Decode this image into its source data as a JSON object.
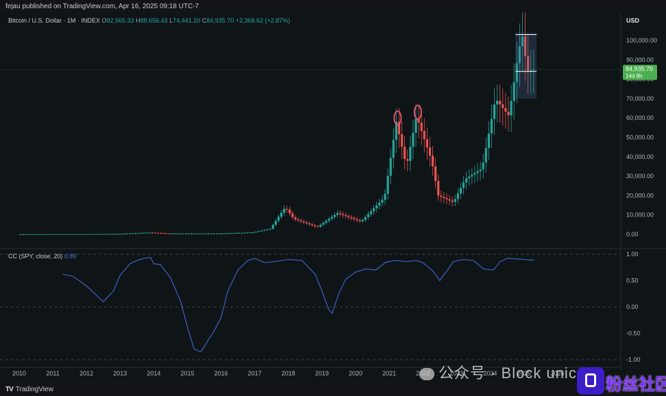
{
  "header": {
    "published": "fejau published on TradingView.com, Apr 16, 2025 09:18 UTC-7"
  },
  "legend": {
    "symbol": "Bitcoin / U.S. Dollar · 1M · INDEX",
    "open_label": "O",
    "open": "82,565.33",
    "high_label": "H",
    "high": "88,656.43",
    "low_label": "L",
    "low": "74,441.20",
    "close_label": "C",
    "close": "84,935.70",
    "change": "+2,368.62 (+2.87%)"
  },
  "axis": {
    "currency": "USD"
  },
  "price_tag": {
    "value": "84,935.70",
    "countdown": "14d 8h"
  },
  "colors": {
    "up": "#26a69a",
    "down": "#ef5350",
    "cc_line": "#3f62c4",
    "price_tag_bg": "#4caf50",
    "highlight": "#e0536b"
  },
  "cc_panel": {
    "label": "CC (SPY, close, 20)",
    "value": "0.89"
  },
  "footer": {
    "logo": "TradingView"
  },
  "overlay": {
    "watermark": "公众号 · Block unicorn",
    "brand": "粉丝社区"
  },
  "chart_data": [
    {
      "type": "candlestick",
      "title": "Bitcoin / U.S. Dollar · 1M · INDEX",
      "x_ticks": [
        "2010",
        "2011",
        "2012",
        "2013",
        "2014",
        "2015",
        "2016",
        "2017",
        "2018",
        "2019",
        "2020",
        "2021",
        "2022",
        "2023",
        "2024",
        "2025",
        "2026"
      ],
      "y_ticks": [
        "0.00",
        "10,000.00",
        "20,000.00",
        "30,000.00",
        "40,000.00",
        "50,000.00",
        "60,000.00",
        "70,000.00",
        "80,000.00",
        "90,000.00",
        "100,000.00"
      ],
      "ylim": [
        -3000,
        106000
      ],
      "price_points": [
        [
          2010.0,
          0
        ],
        [
          2013.0,
          200
        ],
        [
          2013.9,
          900
        ],
        [
          2014.5,
          400
        ],
        [
          2016.0,
          420
        ],
        [
          2017.0,
          1000
        ],
        [
          2017.5,
          2800
        ],
        [
          2017.95,
          14000
        ],
        [
          2018.2,
          8000
        ],
        [
          2018.9,
          3700
        ],
        [
          2019.5,
          11000
        ],
        [
          2020.2,
          6500
        ],
        [
          2020.9,
          19000
        ],
        [
          2021.25,
          58000
        ],
        [
          2021.55,
          35000
        ],
        [
          2021.85,
          61000
        ],
        [
          2022.3,
          38000
        ],
        [
          2022.5,
          20000
        ],
        [
          2022.95,
          16500
        ],
        [
          2023.3,
          28500
        ],
        [
          2023.8,
          34000
        ],
        [
          2024.2,
          70000
        ],
        [
          2024.6,
          61000
        ],
        [
          2024.9,
          96000
        ],
        [
          2025.0,
          102000
        ],
        [
          2025.15,
          84000
        ],
        [
          2025.3,
          84936
        ]
      ],
      "highlighted_peaks": [
        {
          "x": 2021.25,
          "y": 60000
        },
        {
          "x": 2021.85,
          "y": 63000
        }
      ],
      "last_price": 84935.7,
      "grid": false
    },
    {
      "type": "line",
      "title": "CC (SPY, close, 20)",
      "y_ticks": [
        "1.00",
        "0.50",
        "0.00",
        "-0.50",
        "-1.00"
      ],
      "ylim": [
        -1.05,
        1.05
      ],
      "x": [
        2011.3,
        2011.6,
        2012.0,
        2012.3,
        2012.5,
        2012.8,
        2013.0,
        2013.3,
        2013.5,
        2013.7,
        2013.9,
        2014.0,
        2014.2,
        2014.5,
        2014.8,
        2015.0,
        2015.2,
        2015.4,
        2015.6,
        2015.8,
        2016.0,
        2016.2,
        2016.5,
        2016.8,
        2017.0,
        2017.3,
        2017.6,
        2018.0,
        2018.4,
        2018.8,
        2019.0,
        2019.2,
        2019.3,
        2019.5,
        2019.7,
        2020.0,
        2020.3,
        2020.6,
        2020.9,
        2021.2,
        2021.5,
        2021.8,
        2022.0,
        2022.3,
        2022.5,
        2022.8,
        2022.9,
        2023.2,
        2023.5,
        2023.8,
        2024.1,
        2024.3,
        2024.5,
        2024.8,
        2025.0,
        2025.2,
        2025.3
      ],
      "values": [
        0.62,
        0.58,
        0.4,
        0.22,
        0.1,
        0.3,
        0.6,
        0.82,
        0.88,
        0.92,
        0.94,
        0.82,
        0.8,
        0.55,
        0.1,
        -0.38,
        -0.8,
        -0.85,
        -0.65,
        -0.45,
        -0.2,
        0.3,
        0.7,
        0.88,
        0.92,
        0.84,
        0.86,
        0.9,
        0.88,
        0.62,
        0.3,
        -0.05,
        -0.12,
        0.25,
        0.52,
        0.66,
        0.72,
        0.7,
        0.85,
        0.88,
        0.86,
        0.88,
        0.84,
        0.68,
        0.5,
        0.76,
        0.86,
        0.9,
        0.88,
        0.72,
        0.7,
        0.86,
        0.92,
        0.91,
        0.9,
        0.89,
        0.89
      ]
    }
  ]
}
